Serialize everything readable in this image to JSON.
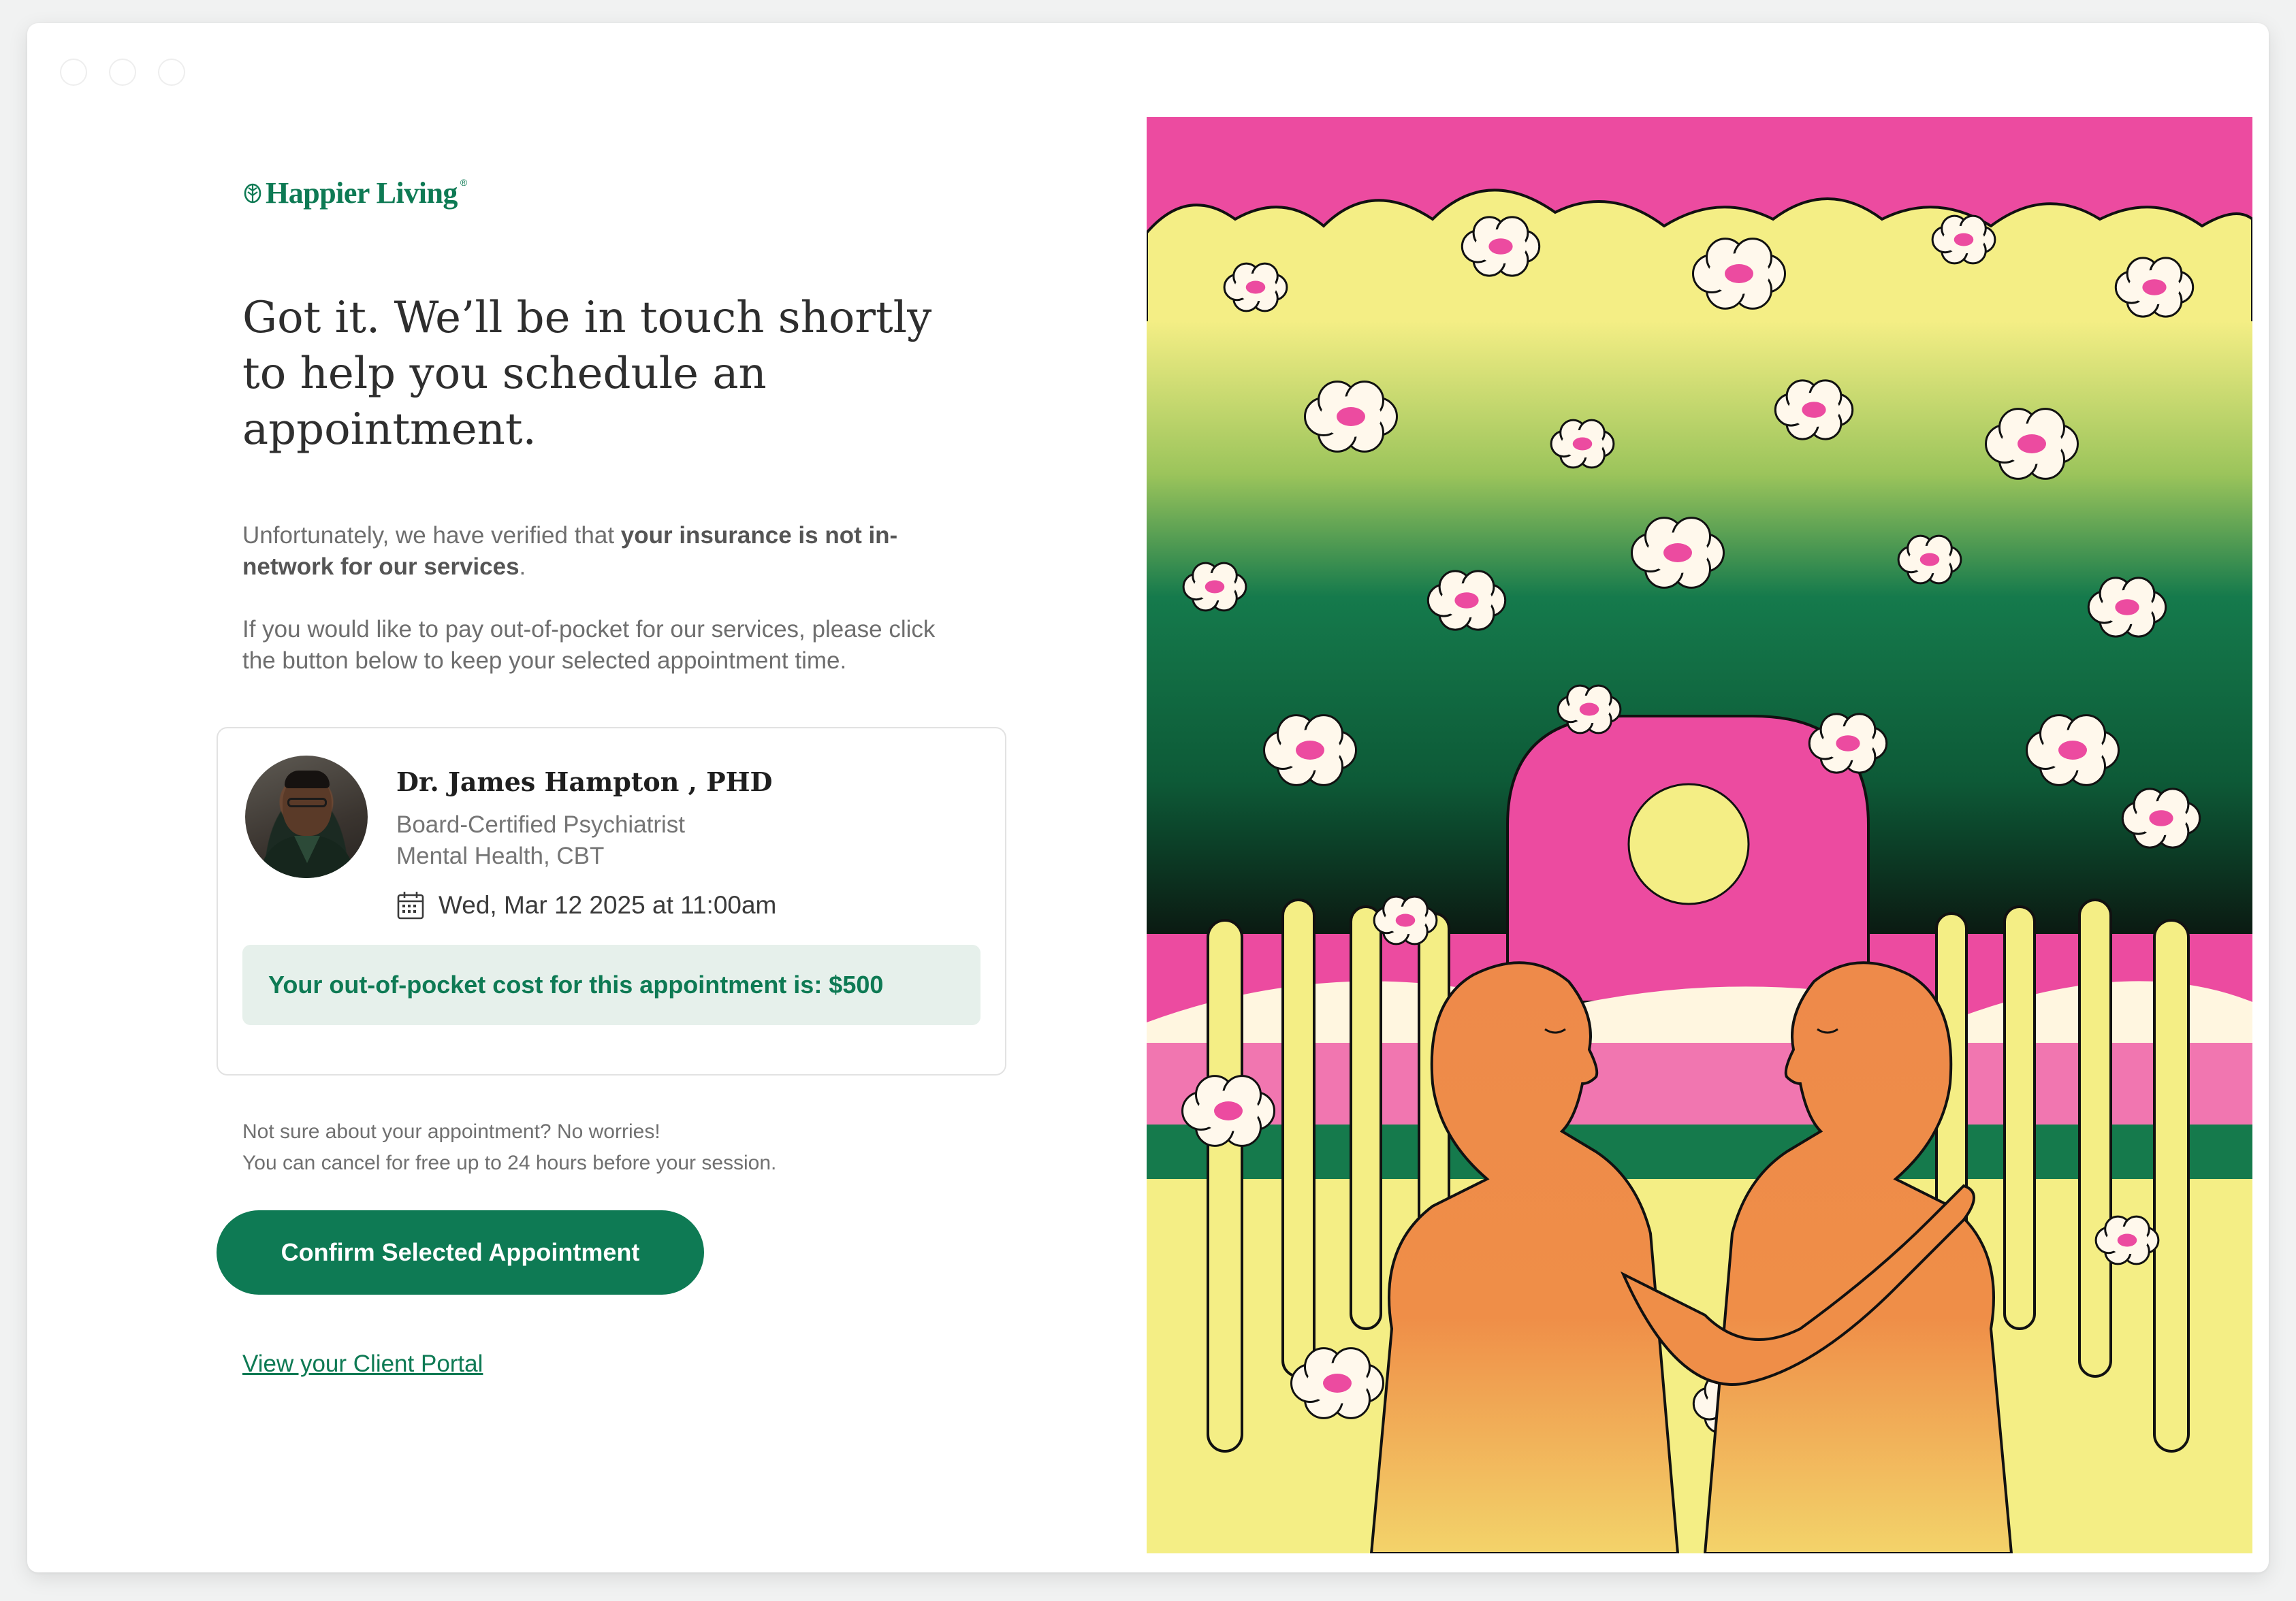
{
  "brand": {
    "name": "Happier Living",
    "registered_mark": "®",
    "color": "#0e7a54"
  },
  "headline": "Got it. We’ll be in touch shortly to help you schedule an appointment.",
  "intro": {
    "p1_prefix": "Unfortunately, we have verified that ",
    "p1_bold": "your insurance is not in-network for our services",
    "p1_suffix": ".",
    "p2": "If you would like to pay out-of-pocket for our services, please click the button below to keep your selected appointment time."
  },
  "provider": {
    "name": "Dr. James Hampton , PHD",
    "title": "Board-Certified Psychiatrist",
    "specialties": "Mental Health, CBT",
    "appointment": "Wed, Mar 12 2025 at 11:00am",
    "avatar_icon": "provider-photo"
  },
  "cost_message": "Your out-of-pocket cost for this appointment is: $500",
  "note": {
    "line1": "Not sure about your appointment? No worries!",
    "line2": "You can cancel for free up to 24 hours before your session."
  },
  "actions": {
    "confirm_label": "Confirm Selected Appointment",
    "portal_link": "View your Client Portal"
  },
  "colors": {
    "primary": "#0e7a54",
    "cost_bg": "#e6f0eb",
    "art_pink": "#ec4ba0",
    "art_yellow": "#f4ee85",
    "art_green": "#157a4c",
    "art_orange": "#ee8a4a"
  }
}
